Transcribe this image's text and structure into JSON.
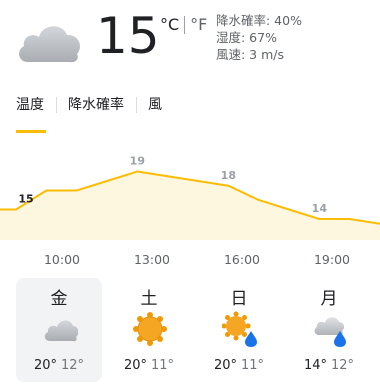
{
  "current": {
    "icon": "cloudy-icon",
    "temperature": "15",
    "unit_c": "°C",
    "unit_f": "°F",
    "precipitation": "降水確率: 40%",
    "humidity": "湿度: 67%",
    "wind": "風速: 3 m/s"
  },
  "tabs": [
    {
      "label": "温度",
      "active": true
    },
    {
      "label": "降水確率",
      "active": false
    },
    {
      "label": "風",
      "active": false
    }
  ],
  "colors": {
    "accent": "#fbbc04",
    "chart_fill": "#fef7e0",
    "sun": "#f5a623",
    "rain": "#1a73e8",
    "cloud": "#bdc1c6"
  },
  "chart_data": {
    "type": "area",
    "x": [
      "9:00",
      "10:00",
      "11:00",
      "12:00",
      "13:00",
      "14:00",
      "15:00",
      "16:00",
      "17:00",
      "18:00",
      "19:00",
      "20:00",
      "21:00"
    ],
    "values": [
      15,
      17,
      17,
      18,
      19,
      18.5,
      18,
      17.5,
      16,
      15,
      14,
      14,
      13.5
    ],
    "point_labels": [
      {
        "index": 0,
        "text": "15"
      },
      {
        "index": 4,
        "text": "19"
      },
      {
        "index": 7,
        "text": "18"
      },
      {
        "index": 10,
        "text": "14"
      }
    ],
    "ylim": [
      12,
      20
    ],
    "grid": false
  },
  "hours": [
    "10:00",
    "13:00",
    "16:00",
    "19:00"
  ],
  "days": [
    {
      "name": "金",
      "icon": "cloudy-icon",
      "high": "20°",
      "low": "12°",
      "active": true
    },
    {
      "name": "土",
      "icon": "sunny-icon",
      "high": "20°",
      "low": "11°",
      "active": false
    },
    {
      "name": "日",
      "icon": "sun-rain-icon",
      "high": "20°",
      "low": "11°",
      "active": false
    },
    {
      "name": "月",
      "icon": "cloud-rain-icon",
      "high": "14°",
      "low": "12°",
      "active": false
    }
  ]
}
